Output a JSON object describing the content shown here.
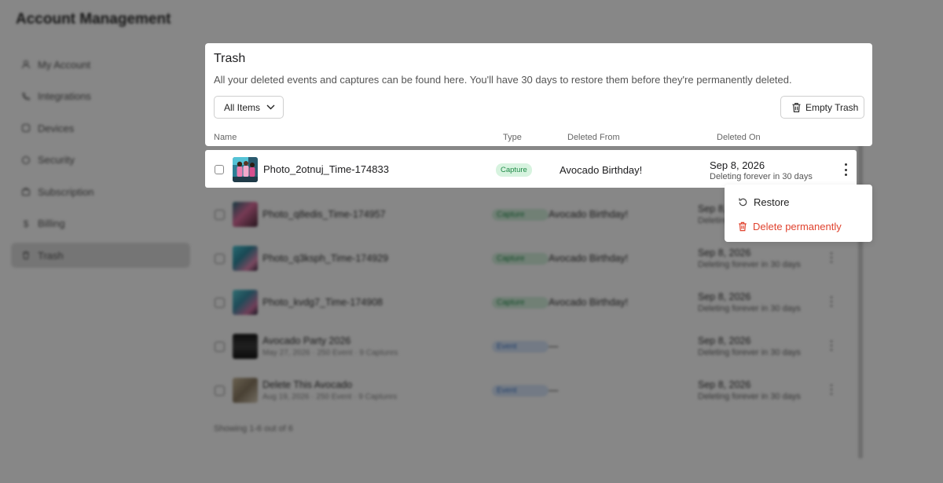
{
  "app": {
    "title": "Account Management"
  },
  "sidebar": {
    "items": [
      {
        "label": "My Account",
        "icon": "user-icon"
      },
      {
        "label": "Integrations",
        "icon": "phone-icon"
      },
      {
        "label": "Devices",
        "icon": "device-icon"
      },
      {
        "label": "Security",
        "icon": "shield-icon"
      },
      {
        "label": "Subscription",
        "icon": "briefcase-icon"
      },
      {
        "label": "Billing",
        "icon": "dollar-icon"
      },
      {
        "label": "Trash",
        "icon": "trash-icon",
        "active": true
      }
    ]
  },
  "trash": {
    "title": "Trash",
    "description": "All your deleted events and captures can be found here. You'll have 30 days to restore them before they're permanently deleted.",
    "filter_label": "All Items",
    "empty_label": "Empty Trash",
    "columns": {
      "name": "Name",
      "type": "Type",
      "from": "Deleted From",
      "on": "Deleted On"
    }
  },
  "focused_row": {
    "name": "Photo_2otnuj_Time-174833",
    "type": "Capture",
    "from": "Avocado Birthday!",
    "date": "Sep 8, 2026",
    "date_sub": "Deleting forever in 30 days"
  },
  "rows": [
    {
      "name": "Photo_q8edis_Time-174957",
      "sub": "",
      "type": "Capture",
      "type_kind": "capture",
      "from": "Avocado Birthday!",
      "date": "Sep 8, 2026",
      "date_sub": "Deleting forever in 30 days"
    },
    {
      "name": "Photo_q3ksph_Time-174929",
      "sub": "",
      "type": "Capture",
      "type_kind": "capture",
      "from": "Avocado Birthday!",
      "date": "Sep 8, 2026",
      "date_sub": "Deleting forever in 30 days"
    },
    {
      "name": "Photo_kvdg7_Time-174908",
      "sub": "",
      "type": "Capture",
      "type_kind": "capture",
      "from": "Avocado Birthday!",
      "date": "Sep 8, 2026",
      "date_sub": "Deleting forever in 30 days"
    },
    {
      "name": "Avocado Party 2026",
      "sub": "May 27, 2026 · 250 Event · 9 Captures",
      "type": "Event",
      "type_kind": "event",
      "from": "—",
      "date": "Sep 8, 2026",
      "date_sub": "Deleting forever in 30 days"
    },
    {
      "name": "Delete This Avocado",
      "sub": "Aug 19, 2026 · 250 Event · 9 Captures",
      "type": "Event",
      "type_kind": "event",
      "from": "—",
      "date": "Sep 8, 2026",
      "date_sub": "Deleting forever in 30 days"
    }
  ],
  "footer": {
    "showing": "Showing 1-6 out of 6"
  },
  "menu": {
    "restore": "Restore",
    "delete": "Delete permanently"
  },
  "colors": {
    "delete_red": "#e0432f",
    "capture_green": "#1f8a47",
    "event_blue": "#3c76c8"
  }
}
